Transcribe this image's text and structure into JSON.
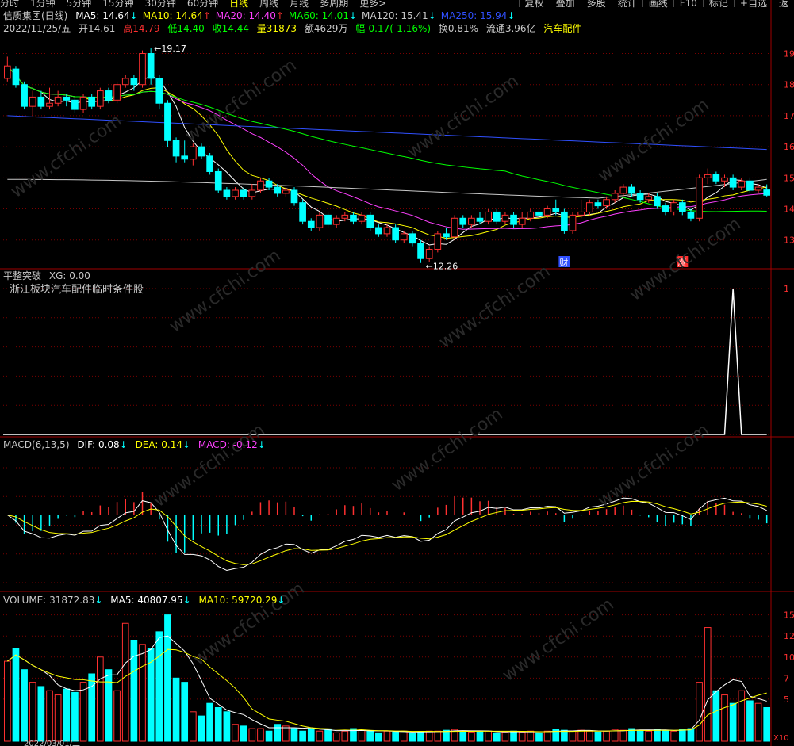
{
  "period_tabs": [
    "分时",
    "1分钟",
    "5分钟",
    "15分钟",
    "30分钟",
    "60分钟",
    "日线",
    "周线",
    "月线",
    "多周期",
    "更多>"
  ],
  "active_tab": "日线",
  "toolbar": [
    "复权",
    "叠加",
    "多股",
    "统计",
    "画线",
    "F10",
    "标记",
    "+自选",
    "返"
  ],
  "price_panel": {
    "title": "信质集团(日线)",
    "ma": [
      {
        "label": "MA5: 14.64",
        "arrow": "↓",
        "color": "#ffffff"
      },
      {
        "label": "MA10: 14.64",
        "arrow": "↑",
        "color": "#ffff00"
      },
      {
        "label": "MA20: 14.40",
        "arrow": "↑",
        "color": "#ff40ff"
      },
      {
        "label": "MA60: 14.01",
        "arrow": "↓",
        "color": "#00ff00"
      },
      {
        "label": "MA120: 15.41",
        "arrow": "↓",
        "color": "#c8c8c8"
      },
      {
        "label": "MA250: 15.94",
        "arrow": "↓",
        "color": "#3050ff"
      }
    ],
    "info": {
      "date": "2022/11/25/五",
      "open": "开14.61",
      "high": "高14.79",
      "low": "低14.40",
      "close": "收14.44",
      "volume": "量31873",
      "amount": "额4629万",
      "change": "幅-0.17(-1.16%)",
      "turnover": "换0.81%",
      "float": "流通3.96亿",
      "sector": "汽车配件"
    },
    "high_label": "19.17",
    "low_label": "12.26",
    "event_marks": [
      "财",
      "涨"
    ],
    "axis": [
      "19",
      "18",
      "17",
      "16",
      "15",
      "14",
      "13"
    ]
  },
  "signal_panel": {
    "title": "平整突破",
    "xg": "XG: 0.00",
    "note": "浙江板块汽车配件临时条件股",
    "axis": [
      "1",
      "",
      "",
      "",
      "",
      ""
    ]
  },
  "macd_panel": {
    "title": "MACD(6,13,5)",
    "dif": "DIF: 0.08",
    "dea": "DEA: 0.14",
    "macd": "MACD: -0.12",
    "arrow": "↓",
    "axis": [
      "",
      "",
      "",
      "",
      ""
    ]
  },
  "volume_panel": {
    "title": "VOLUME: 31872.83",
    "ma5": "MA5: 40807.95",
    "ma10": "MA10: 59720.29",
    "arrow": "↓",
    "axis": [
      "15",
      "12",
      "10",
      "7",
      "5"
    ],
    "unit": "X10",
    "bottom_date": "2022/03/01/二"
  },
  "watermark": "www.cfchi.com",
  "colors": {
    "up": "#ff3030",
    "down": "#00ffff",
    "ma5": "#ffffff",
    "ma10": "#ffff00",
    "ma20": "#ff40ff",
    "ma60": "#00ff00",
    "ma120": "#c8c8c8",
    "ma250": "#3050ff",
    "grid": "#7a0000"
  },
  "chart_data": {
    "type": "candlestick",
    "price_range": [
      12.1,
      19.6
    ],
    "candles": [
      [
        18.2,
        18.6,
        18.9,
        18.1
      ],
      [
        18.5,
        18.0,
        18.6,
        17.9
      ],
      [
        18.0,
        17.3,
        18.1,
        17.2
      ],
      [
        17.3,
        17.6,
        17.8,
        17.0
      ],
      [
        17.6,
        17.3,
        17.8,
        17.2
      ],
      [
        17.3,
        17.4,
        17.9,
        17.2
      ],
      [
        17.4,
        17.6,
        17.8,
        17.3
      ],
      [
        17.6,
        17.5,
        17.7,
        17.3
      ],
      [
        17.5,
        17.2,
        17.6,
        17.1
      ],
      [
        17.2,
        17.6,
        17.7,
        17.1
      ],
      [
        17.6,
        17.3,
        17.7,
        17.2
      ],
      [
        17.3,
        17.8,
        17.9,
        17.2
      ],
      [
        17.8,
        17.5,
        17.9,
        17.4
      ],
      [
        17.5,
        18.0,
        18.1,
        17.4
      ],
      [
        18.0,
        18.2,
        18.3,
        17.9
      ],
      [
        18.2,
        18.0,
        18.3,
        17.8
      ],
      [
        18.0,
        19.0,
        19.1,
        17.9
      ],
      [
        19.0,
        18.2,
        19.17,
        18.0
      ],
      [
        18.2,
        17.4,
        18.3,
        17.2
      ],
      [
        17.4,
        16.2,
        17.5,
        16.0
      ],
      [
        16.2,
        15.7,
        16.3,
        15.5
      ],
      [
        15.7,
        15.6,
        16.2,
        15.5
      ],
      [
        15.6,
        16.0,
        16.1,
        15.4
      ],
      [
        16.0,
        15.7,
        16.1,
        15.6
      ],
      [
        15.7,
        15.2,
        15.8,
        15.1
      ],
      [
        15.2,
        14.6,
        15.3,
        14.5
      ],
      [
        14.6,
        14.4,
        14.7,
        14.3
      ],
      [
        14.4,
        14.6,
        14.7,
        14.3
      ],
      [
        14.6,
        14.4,
        14.7,
        14.3
      ],
      [
        14.4,
        14.6,
        14.8,
        14.3
      ],
      [
        14.6,
        14.9,
        15.0,
        14.5
      ],
      [
        14.9,
        14.7,
        15.0,
        14.6
      ],
      [
        14.7,
        14.5,
        14.8,
        14.4
      ],
      [
        14.5,
        14.6,
        14.7,
        14.4
      ],
      [
        14.6,
        14.2,
        14.7,
        14.1
      ],
      [
        14.2,
        13.6,
        14.3,
        13.5
      ],
      [
        13.6,
        13.4,
        13.7,
        13.3
      ],
      [
        13.4,
        13.8,
        13.9,
        13.3
      ],
      [
        13.8,
        13.5,
        13.9,
        13.4
      ],
      [
        13.5,
        13.7,
        13.8,
        13.4
      ],
      [
        13.7,
        13.8,
        13.9,
        13.6
      ],
      [
        13.8,
        13.6,
        13.9,
        13.5
      ],
      [
        13.6,
        13.8,
        13.9,
        13.5
      ],
      [
        13.8,
        13.4,
        13.9,
        13.3
      ],
      [
        13.4,
        13.2,
        13.5,
        13.1
      ],
      [
        13.2,
        13.4,
        13.5,
        13.1
      ],
      [
        13.4,
        13.0,
        13.5,
        12.9
      ],
      [
        13.0,
        13.2,
        13.3,
        12.9
      ],
      [
        13.2,
        12.9,
        13.3,
        12.8
      ],
      [
        12.9,
        12.4,
        13.0,
        12.26
      ],
      [
        12.4,
        12.7,
        12.8,
        12.3
      ],
      [
        12.7,
        13.2,
        13.3,
        12.6
      ],
      [
        13.2,
        13.1,
        13.4,
        13.0
      ],
      [
        13.1,
        13.7,
        13.8,
        13.0
      ],
      [
        13.7,
        13.5,
        13.8,
        13.4
      ],
      [
        13.5,
        13.7,
        13.8,
        13.4
      ],
      [
        13.7,
        13.6,
        13.9,
        13.5
      ],
      [
        13.6,
        13.9,
        14.0,
        13.5
      ],
      [
        13.9,
        13.6,
        14.0,
        13.5
      ],
      [
        13.6,
        13.8,
        13.9,
        13.5
      ],
      [
        13.8,
        13.5,
        13.9,
        13.4
      ],
      [
        13.5,
        13.7,
        13.9,
        13.4
      ],
      [
        13.7,
        13.9,
        14.0,
        13.6
      ],
      [
        13.9,
        13.8,
        14.0,
        13.7
      ],
      [
        13.8,
        14.0,
        14.1,
        13.7
      ],
      [
        14.0,
        13.9,
        14.3,
        13.8
      ],
      [
        13.9,
        13.3,
        14.0,
        13.2
      ],
      [
        13.3,
        13.8,
        13.9,
        13.2
      ],
      [
        13.8,
        13.9,
        14.3,
        13.7
      ],
      [
        13.9,
        14.2,
        14.3,
        13.8
      ],
      [
        14.2,
        14.1,
        14.3,
        14.0
      ],
      [
        14.1,
        14.3,
        14.4,
        14.0
      ],
      [
        14.3,
        14.5,
        14.6,
        14.2
      ],
      [
        14.5,
        14.7,
        14.8,
        14.4
      ],
      [
        14.7,
        14.5,
        14.8,
        14.4
      ],
      [
        14.5,
        14.3,
        14.6,
        14.2
      ],
      [
        14.3,
        14.4,
        14.5,
        14.2
      ],
      [
        14.4,
        14.1,
        14.5,
        14.0
      ],
      [
        14.1,
        13.9,
        14.2,
        13.8
      ],
      [
        13.9,
        14.2,
        14.3,
        13.8
      ],
      [
        14.2,
        13.9,
        14.3,
        13.8
      ],
      [
        13.9,
        13.7,
        14.0,
        13.6
      ],
      [
        13.7,
        15.0,
        15.1,
        13.6
      ],
      [
        15.0,
        15.1,
        15.3,
        14.8
      ],
      [
        15.1,
        14.9,
        15.2,
        14.8
      ],
      [
        14.9,
        15.0,
        15.1,
        14.7
      ],
      [
        15.0,
        14.7,
        15.1,
        14.6
      ],
      [
        14.7,
        14.9,
        15.0,
        14.6
      ],
      [
        14.9,
        14.6,
        15.0,
        14.5
      ],
      [
        14.6,
        14.7,
        14.8,
        14.5
      ],
      [
        14.61,
        14.44,
        14.79,
        14.4
      ]
    ],
    "volume": [
      95,
      110,
      85,
      70,
      65,
      60,
      55,
      62,
      58,
      70,
      80,
      100,
      85,
      60,
      140,
      120,
      115,
      110,
      130,
      150,
      75,
      70,
      35,
      30,
      45,
      40,
      35,
      20,
      18,
      15,
      15,
      12,
      20,
      18,
      15,
      12,
      15,
      12,
      14,
      10,
      12,
      15,
      13,
      12,
      10,
      12,
      11,
      12,
      10,
      11,
      12,
      12,
      13,
      14,
      12,
      11,
      12,
      12,
      10,
      11,
      12,
      11,
      12,
      10,
      12,
      14,
      13,
      12,
      13,
      12,
      11,
      12,
      14,
      13,
      15,
      13,
      12,
      14,
      13,
      12,
      14,
      15,
      70,
      135,
      60,
      55,
      45,
      60,
      48,
      45,
      40
    ],
    "signal": {
      "peak_index": 86,
      "value": 1
    }
  }
}
